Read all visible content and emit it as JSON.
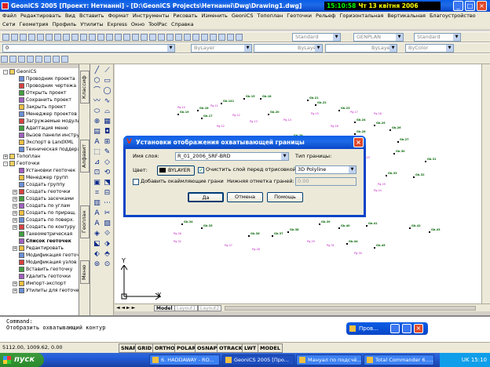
{
  "window": {
    "title": "GeoniCS 2005 [Проект: Нетнанні] - [D:\\GeoniCS Projects\\Нетнанні\\Dwg\\Drawing1.dwg]",
    "clock_time": "15:10:58",
    "clock_date": "Чт 13 квітня 2006",
    "minimize_label": "_",
    "maximize_label": "□",
    "close_label": "×"
  },
  "menu_row1": [
    "Файл",
    "Редактировать",
    "Вид",
    "Вставить",
    "Формат",
    "Инструменты",
    "Рисовать",
    "Изменить",
    "GeoniCS",
    "Топоплан",
    "Геоточки",
    "Рельеф",
    "Горизонтальная",
    "Вертикальная",
    "Благоустройство"
  ],
  "menu_row2": [
    "Сети",
    "Геометрия",
    "Профиль",
    "Утилиты",
    "Express",
    "Окно",
    "ToolPac",
    "Справка"
  ],
  "toolbar": {
    "style1": "Standard",
    "style2": "GENPLAN",
    "style3": "Standard",
    "layer": "0",
    "color1": "ByLayer",
    "linetype": "ByLayer",
    "lineweight": "ByLayer",
    "plotstyle": "ByColor"
  },
  "tree": [
    {
      "label": "GeoniCS",
      "exp": "-",
      "indent": 0
    },
    {
      "label": "Проводник проекта",
      "exp": "",
      "indent": 1
    },
    {
      "label": "Проводник чертежа",
      "exp": "",
      "indent": 1
    },
    {
      "label": "Открыть проект",
      "exp": "",
      "indent": 1
    },
    {
      "label": "Сохранить проект",
      "exp": "",
      "indent": 1
    },
    {
      "label": "Закрыть проект",
      "exp": "",
      "indent": 1
    },
    {
      "label": "Менеджер проектов",
      "exp": "",
      "indent": 1
    },
    {
      "label": "Загружаемые модули",
      "exp": "",
      "indent": 1
    },
    {
      "label": "Адаптация меню",
      "exp": "",
      "indent": 1
    },
    {
      "label": "Вызов панели инструм.",
      "exp": "",
      "indent": 1
    },
    {
      "label": "Экспорт в LandXML",
      "exp": "",
      "indent": 1
    },
    {
      "label": "Техническая поддержка",
      "exp": "",
      "indent": 1
    },
    {
      "label": "Топоплан",
      "exp": "+",
      "indent": 0
    },
    {
      "label": "Геоточки",
      "exp": "-",
      "indent": 0
    },
    {
      "label": "Установки геоточек",
      "exp": "",
      "indent": 1
    },
    {
      "label": "Менеджер групп",
      "exp": "",
      "indent": 1
    },
    {
      "label": "Создать группу",
      "exp": "",
      "indent": 1
    },
    {
      "label": "Создать геоточки",
      "exp": "+",
      "indent": 1
    },
    {
      "label": "Создать засечками",
      "exp": "+",
      "indent": 1
    },
    {
      "label": "Создать по углам",
      "exp": "+",
      "indent": 1
    },
    {
      "label": "Создать по приращ.",
      "exp": "+",
      "indent": 1
    },
    {
      "label": "Создать по поверх.",
      "exp": "+",
      "indent": 1
    },
    {
      "label": "Создать по контуру",
      "exp": "+",
      "indent": 1
    },
    {
      "label": "Тахеометрическая",
      "exp": "",
      "indent": 1
    },
    {
      "label": "Список геоточек",
      "exp": "",
      "indent": 1,
      "bold": true
    },
    {
      "label": "Редактировать",
      "exp": "+",
      "indent": 1
    },
    {
      "label": "Модификация геоточек",
      "exp": "",
      "indent": 1
    },
    {
      "label": "Модификация узлов",
      "exp": "",
      "indent": 1
    },
    {
      "label": "Вставить геоточку",
      "exp": "",
      "indent": 1
    },
    {
      "label": "Удалить геоточки",
      "exp": "",
      "indent": 1
    },
    {
      "label": "Импорт-экспорт",
      "exp": "+",
      "indent": 1
    },
    {
      "label": "Утилиты для геоточек",
      "exp": "+",
      "indent": 1
    }
  ],
  "vtabs": [
    "Классиф",
    "Алфавит",
    "Геоплан",
    "Меню"
  ],
  "tools": [
    "╱",
    "⟋",
    "⬡",
    "▭",
    "⌒",
    "◯",
    "〰",
    "∿",
    "⬭",
    "⌓",
    "⊕",
    "▦",
    "▤",
    "◘",
    "A",
    "⊞",
    "⬚",
    "✎",
    "⊿",
    "◇",
    "⊡",
    "⟲",
    "▣",
    "⬔",
    "⌗",
    "⊟",
    "▥",
    "⋯",
    "A",
    "✂",
    "A",
    "▨",
    "◈",
    "⟐",
    "⬕",
    "⬗",
    "⬖",
    "⬘",
    "⊚",
    "⊙"
  ],
  "layout_tabs": {
    "model": "Model",
    "layout1": "Layout1",
    "layout2": "Layout2"
  },
  "ucs": {
    "y": "Y",
    "x": "X"
  },
  "dialog": {
    "title": "Установки отображения охватывающей границы",
    "close_label": "×",
    "layer_name_label": "Имя слоя:",
    "layer_name_value": "R_01_2006_SRF-BRD",
    "boundary_type_label": "Тип границы:",
    "boundary_type_value": "3D Polyline",
    "color_label": "Цвет:",
    "color_value": "BYLAYER",
    "clear_layer_label": "Очистить слой перед отрисовкой",
    "clear_layer_checked": "✓",
    "add_edges_label": "Добавить окаймляющие грани",
    "bottom_mark_label": "Нижняя отметка граней:",
    "bottom_mark_value": "0.00",
    "ok_label": "Да",
    "cancel_label": "Отмена",
    "help_label": "Помощь"
  },
  "command": {
    "line1": "Command:",
    "line2": "Отобразить охватывающий контур"
  },
  "floating_panel": {
    "title": "Пров..."
  },
  "status": {
    "coords": "5112.00, 1009.62, 0.00",
    "buttons": [
      "SNAP",
      "GRID",
      "ORTHO",
      "POLAR",
      "OSNAP",
      "OTRACK",
      "LWT",
      "MODEL"
    ]
  },
  "taskbar": {
    "start": "пуск",
    "tasks": [
      "6. HADDAWAY - RO...",
      "GeoniCS 2005 [Про...",
      "Мануал по подсчё...",
      "Total Commander 6....."
    ],
    "tray_lang": "UK",
    "tray_time": "15:10"
  },
  "points_green": [
    "Gb.141",
    "Gb.15",
    "Gb.16",
    "Gb.17",
    "Gb.18",
    "Gb.19",
    "Gb.20",
    "Gb.21",
    "Gb.22",
    "Gb.23",
    "Gb.24",
    "Gb.25",
    "Gb.26",
    "Gb.27",
    "Gb.28",
    "Gb.29",
    "Gb.30",
    "Gb.31",
    "Gb.32",
    "Gb.33",
    "Gb.34",
    "Gb.35",
    "Gb.36",
    "Gb.37",
    "Gb.38",
    "Gb.39",
    "Gb.40",
    "Gb.41",
    "Gb.42",
    "Gb.43",
    "Gb.44",
    "Gb.45"
  ],
  "points_magenta": [
    "Pg.10",
    "Pg.11",
    "Pg.12",
    "Pg.13",
    "Pg.14",
    "Pg.15",
    "Pg.16",
    "Pg.17",
    "Pg.18",
    "Pg.19",
    "Pg.20",
    "Pg.21",
    "Pg.22",
    "Pg.23",
    "Pg.24",
    "Pg.25",
    "Pg.26",
    "Pg.27",
    "Pg.28",
    "Pg.29",
    "Pg.30",
    "Pg.31",
    "Pg.32"
  ]
}
